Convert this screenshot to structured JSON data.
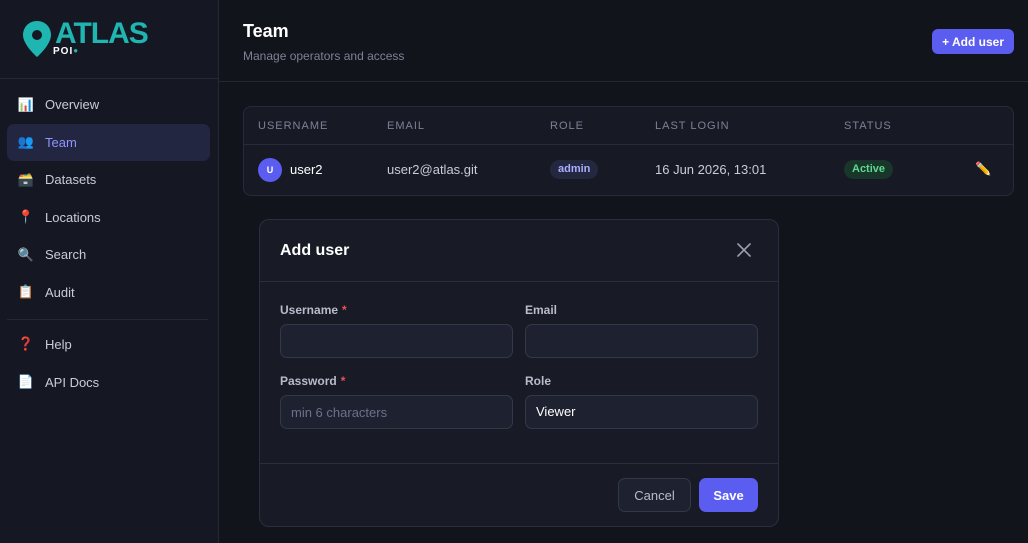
{
  "brand": {
    "name": "ATLAS",
    "sub": "POI",
    "accent": "#1fb5b0"
  },
  "sidebar": {
    "items": [
      {
        "label": "Overview",
        "icon": "bar-chart-icon",
        "glyph": "📊"
      },
      {
        "label": "Team",
        "icon": "users-icon",
        "glyph": "👥",
        "active": true
      },
      {
        "label": "Datasets",
        "icon": "box-icon",
        "glyph": "🗃️"
      },
      {
        "label": "Locations",
        "icon": "pin-icon",
        "glyph": "📍"
      },
      {
        "label": "Search",
        "icon": "magnifier-icon",
        "glyph": "🔍"
      },
      {
        "label": "Audit",
        "icon": "clipboard-icon",
        "glyph": "📋"
      }
    ],
    "bottom_items": [
      {
        "label": "Help",
        "icon": "question-icon",
        "glyph": "❓"
      },
      {
        "label": "API Docs",
        "icon": "document-icon",
        "glyph": "📄"
      }
    ]
  },
  "header": {
    "title": "Team",
    "subtitle": "Manage operators and access",
    "add_label": "+ Add user"
  },
  "table": {
    "columns": [
      "USERNAME",
      "EMAIL",
      "ROLE",
      "LAST LOGIN",
      "STATUS"
    ],
    "rows": [
      {
        "avatar": "U",
        "username": "user2",
        "email": "user2@atlas.git",
        "role": "admin",
        "last_login": "16 Jun 2026, 13:01",
        "status": "Active"
      }
    ]
  },
  "modal": {
    "title": "Add user",
    "username_label": "Username",
    "username_value": "",
    "email_label": "Email",
    "email_value": "",
    "password_label": "Password",
    "password_placeholder": "min 6 characters",
    "role_label": "Role",
    "role_value": "Viewer",
    "required_mark": "*",
    "cancel_label": "Cancel",
    "save_label": "Save"
  },
  "colors": {
    "primary": "#5b5cf0",
    "active_status": "#5fd88f",
    "required": "#ef4f5a"
  }
}
